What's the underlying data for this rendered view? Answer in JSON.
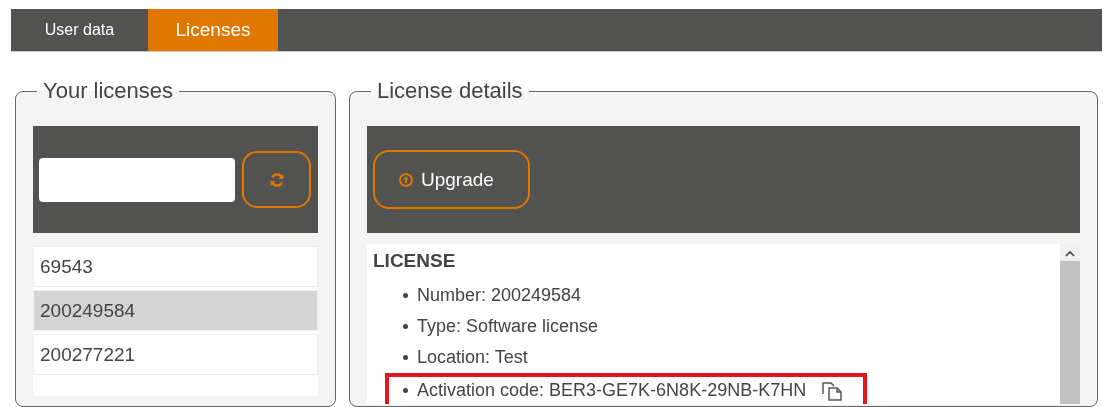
{
  "tabs": [
    {
      "label": "User data",
      "selected": false
    },
    {
      "label": "Licenses",
      "selected": true
    }
  ],
  "licenses_panel": {
    "title": "Your licenses",
    "items": [
      {
        "label": "69543",
        "selected": false
      },
      {
        "label": "200249584",
        "selected": true
      },
      {
        "label": "200277221",
        "selected": false
      }
    ]
  },
  "details_panel": {
    "title": "License details",
    "upgrade_button": "Upgrade",
    "heading": "LICENSE",
    "fields": [
      {
        "text": "Number: 200249584",
        "highlighted": false,
        "copyable": false
      },
      {
        "text": "Type: Software license",
        "highlighted": false,
        "copyable": false
      },
      {
        "text": "Location: Test",
        "highlighted": false,
        "copyable": false
      },
      {
        "text": "Activation code: BER3-GE7K-6N8K-29NB-K7HN",
        "highlighted": true,
        "copyable": true
      }
    ]
  }
}
